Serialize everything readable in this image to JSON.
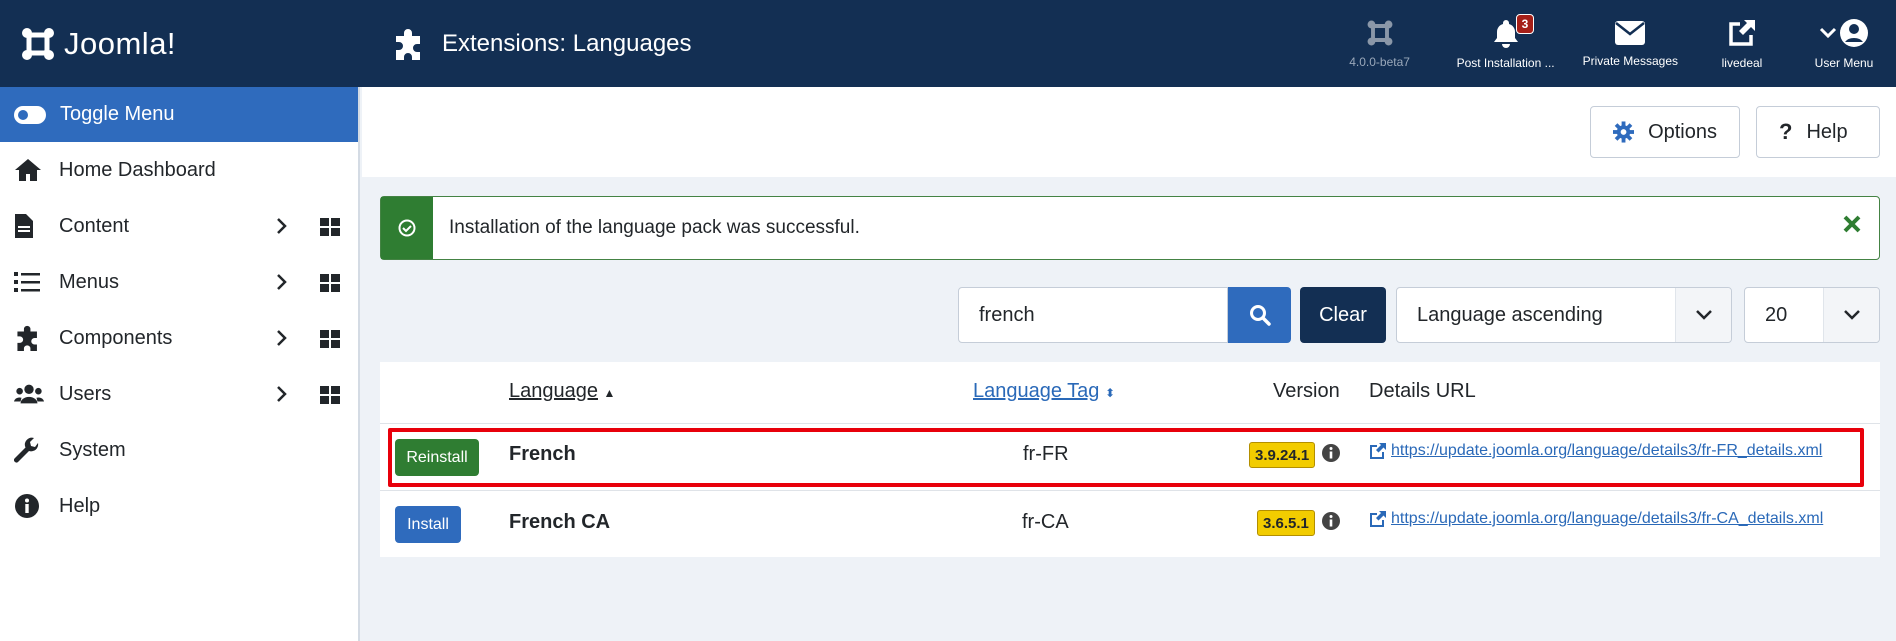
{
  "header": {
    "logo_text": "Joomla!",
    "title": "Extensions: Languages",
    "items": [
      {
        "label": "4.0.0-beta7",
        "icon": "joomla-icon"
      },
      {
        "label": "Post Installation ...",
        "icon": "bell-icon",
        "badge": "3"
      },
      {
        "label": "Private Messages",
        "icon": "envelope-icon"
      },
      {
        "label": "livedeal",
        "icon": "external-link-icon"
      },
      {
        "label": "User Menu",
        "icon": "user-icon"
      }
    ]
  },
  "sidebar": {
    "toggle_label": "Toggle Menu",
    "items": [
      {
        "label": "Home Dashboard",
        "icon": "home-icon"
      },
      {
        "label": "Content",
        "icon": "file-icon"
      },
      {
        "label": "Menus",
        "icon": "list-icon"
      },
      {
        "label": "Components",
        "icon": "puzzle-icon"
      },
      {
        "label": "Users",
        "icon": "users-icon"
      },
      {
        "label": "System",
        "icon": "wrench-icon"
      },
      {
        "label": "Help",
        "icon": "info-icon"
      }
    ]
  },
  "toolbar": {
    "options_label": "Options",
    "help_label": "Help"
  },
  "alert": {
    "message": "Installation of the language pack was successful."
  },
  "filters": {
    "search_value": "french",
    "clear_label": "Clear",
    "sort_value": "Language ascending",
    "limit_value": "20"
  },
  "table": {
    "headers": {
      "language": "Language",
      "tag": "Language Tag",
      "version": "Version",
      "details": "Details URL"
    },
    "rows": [
      {
        "action": "Reinstall",
        "language": "French",
        "tag": "fr-FR",
        "version": "3.9.24.1",
        "url": "https://update.joomla.org/language/details3/fr-FR_details.xml"
      },
      {
        "action": "Install",
        "language": "French CA",
        "tag": "fr-CA",
        "version": "3.6.5.1",
        "url": "https://update.joomla.org/language/details3/fr-CA_details.xml"
      }
    ]
  },
  "colors": {
    "header_bg": "#132f53",
    "accent_blue": "#2f6bbd",
    "success_green": "#2f7d32",
    "badge_yellow": "#f2cc00",
    "highlight_red": "#e8000b"
  }
}
